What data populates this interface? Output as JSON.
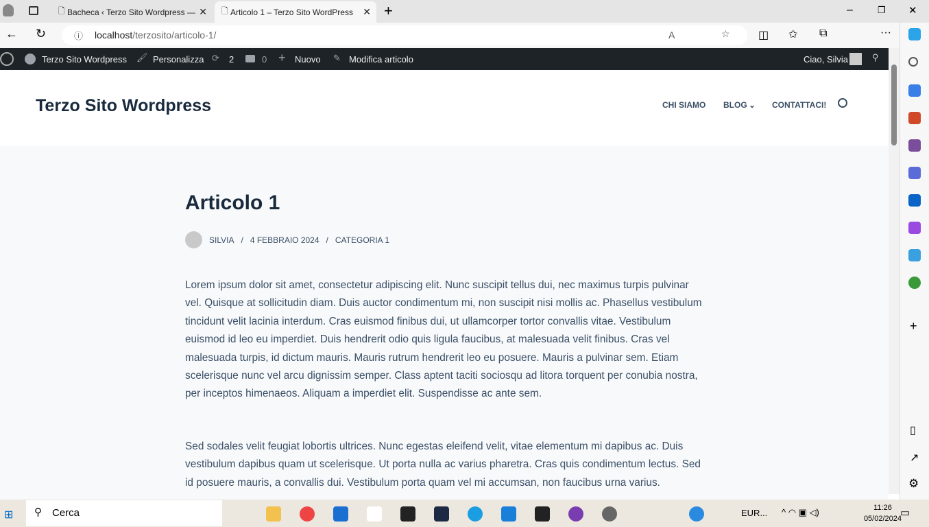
{
  "browser": {
    "tabs": [
      {
        "title": "Bacheca ‹ Terzo Sito Wordpress —"
      },
      {
        "title": "Articolo 1 – Terzo Sito WordPress"
      }
    ],
    "url_host": "localhost",
    "url_path": "/terzosito/articolo-1/"
  },
  "adminbar": {
    "site": "Terzo Sito Wordpress",
    "customize": "Personalizza",
    "updates": "2",
    "comments": "0",
    "new": "Nuovo",
    "edit": "Modifica articolo",
    "greeting": "Ciao, Silvia"
  },
  "site": {
    "title": "Terzo Sito Wordpress",
    "nav": [
      "CHI SIAMO",
      "BLOG",
      "CONTATTACI!"
    ]
  },
  "post": {
    "title": "Articolo 1",
    "author": "SILVIA",
    "date": "4 FEBBRAIO 2024",
    "category": "CATEGORIA 1",
    "paragraphs": [
      "Lorem ipsum dolor sit amet, consectetur adipiscing elit. Nunc suscipit tellus dui, nec maximus turpis pulvinar vel. Quisque at sollicitudin diam. Duis auctor condimentum mi, non suscipit nisi mollis ac. Phasellus vestibulum tincidunt velit lacinia interdum. Cras euismod finibus dui, ut ullamcorper tortor convallis vitae. Vestibulum euismod id leo eu imperdiet. Duis hendrerit odio quis ligula faucibus, at malesuada velit finibus. Cras vel malesuada turpis, id dictum mauris. Mauris rutrum hendrerit leo eu posuere. Mauris a pulvinar sem. Etiam scelerisque nunc vel arcu dignissim semper. Class aptent taciti sociosqu ad litora torquent per conubia nostra, per inceptos himenaeos. Aliquam a imperdiet elit. Suspendisse ac ante sem.",
      "Sed sodales velit feugiat lobortis ultrices. Nunc egestas eleifend velit, vitae elementum mi dapibus ac. Duis vestibulum dapibus quam ut scelerisque. Ut porta nulla ac varius pharetra. Cras quis condimentum lectus. Sed id posuere mauris, a convallis dui. Vestibulum porta quam vel mi accumsan, non faucibus urna varius."
    ]
  },
  "taskbar": {
    "search": "Cerca",
    "weather": "EUR...",
    "time": "11:26",
    "date": "05/02/2024"
  }
}
